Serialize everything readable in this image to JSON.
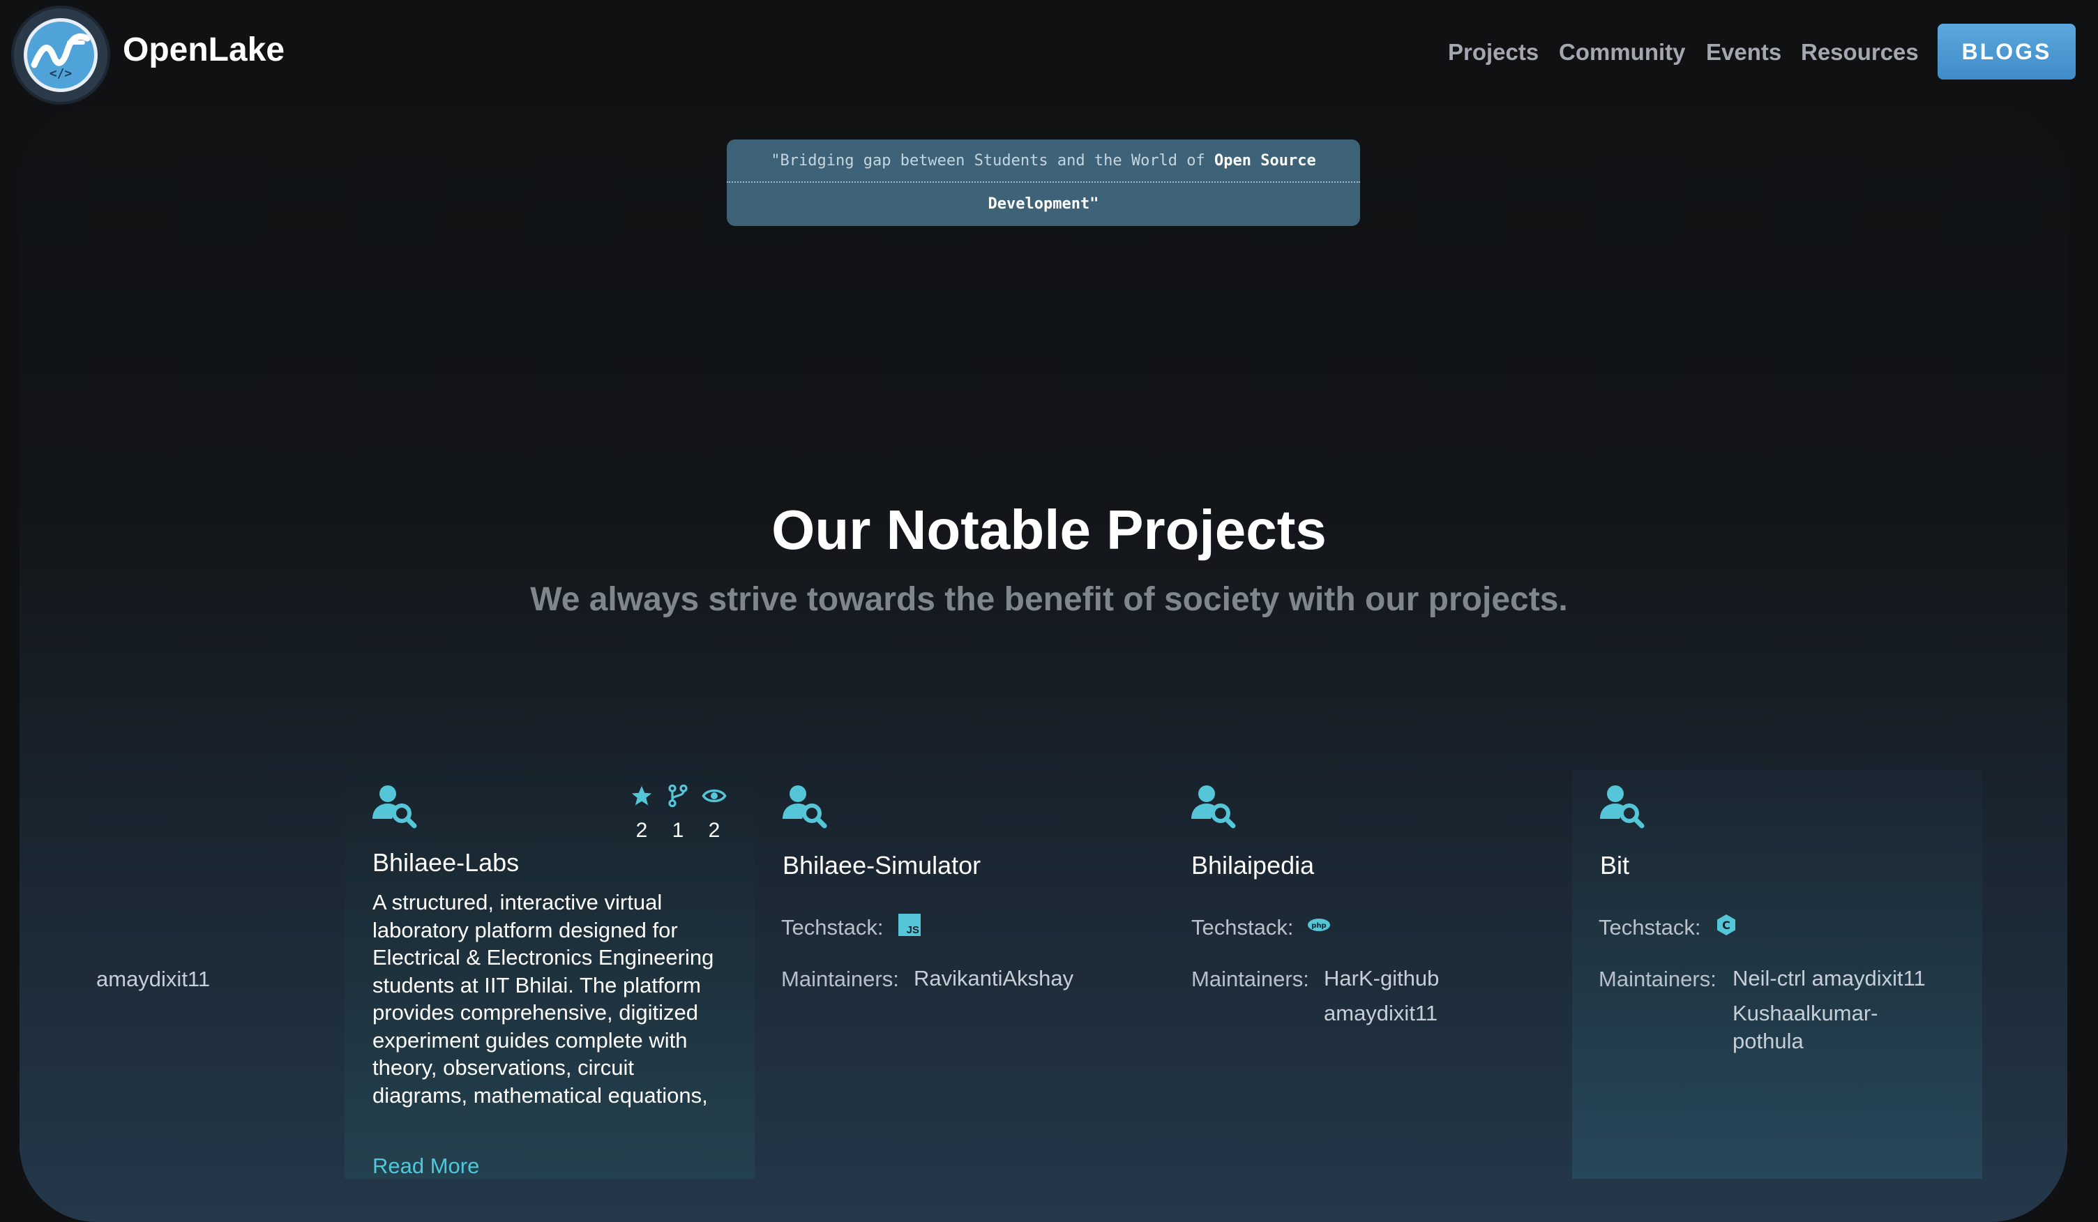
{
  "brand": "OpenLake",
  "nav": {
    "links": [
      "Projects",
      "Community",
      "Events",
      "Resources"
    ],
    "cta": "BLOGS"
  },
  "quote": {
    "line1_plain": "\"Bridging gap between Students and the World of ",
    "line1_bold": "Open Source",
    "line2": "Development\""
  },
  "section": {
    "title": "Our Notable Projects",
    "subtitle": "We always strive towards the benefit of society with our projects."
  },
  "left_card": {
    "maintainer": "amaydixit11"
  },
  "projects": [
    {
      "name": "Bhilaee-Labs",
      "stars": "2",
      "forks": "1",
      "watchers": "2",
      "description": "A structured, interactive virtual laboratory platform designed for Electrical & Electronics Engineering students at IIT Bhilai. The platform provides comprehensive, digitized experiment guides complete with theory, observations, circuit diagrams, mathematical equations,",
      "read_more": "Read More"
    },
    {
      "name": "Bhilaee-Simulator",
      "techstack_label": "Techstack:",
      "tech_icon": "javascript-icon",
      "maintainers_label": "Maintainers:",
      "maintainers": [
        "RavikantiAkshay"
      ]
    },
    {
      "name": "Bhilaipedia",
      "techstack_label": "Techstack:",
      "tech_icon": "php-icon",
      "maintainers_label": "Maintainers:",
      "maintainers": [
        "HarK-github",
        "amaydixit11"
      ]
    },
    {
      "name": "Bit",
      "techstack_label": "Techstack:",
      "tech_icon": "c-language-icon",
      "maintainers_label": "Maintainers:",
      "maintainers": [
        "Neil-ctrl amaydixit11",
        "Kushaalkumar-",
        "pothula"
      ]
    }
  ],
  "colors": {
    "accent": "#4dc9dc",
    "cta": "#4a9ad6",
    "quote_bg": "#3e6277",
    "bg": "#101113"
  }
}
